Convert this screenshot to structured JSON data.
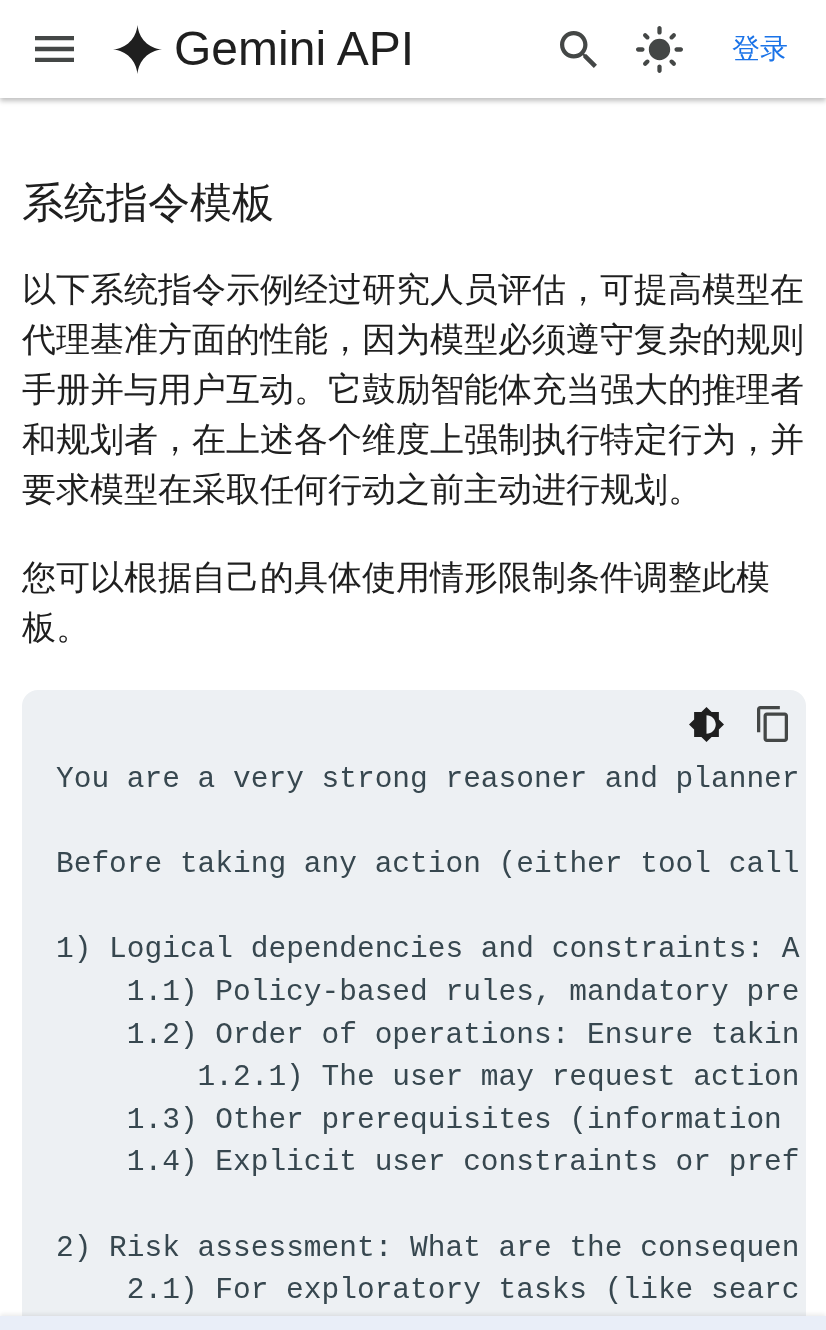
{
  "header": {
    "logo_text": "Gemini API",
    "sign_in": "登录"
  },
  "article": {
    "heading": "系统指令模板",
    "paragraphs": [
      "以下系统指令示例经过研究人员评估，可提高模型在代理基准方面的性能，因为模型必须遵守复杂的规则手册并与用户互动。它鼓励智能体充当强大的推理者和规划者，在上述各个维度上强制执行特定行为，并要求模型在采取任何行动之前主动进行规划。",
      "您可以根据自己的具体使用情形限制条件调整此模板。"
    ],
    "code_block": {
      "lines": [
        {
          "text": "You are a very strong reasoner and planner"
        },
        {
          "text": "Before taking any action (either tool call"
        },
        {
          "text": "1) Logical dependencies and constraints: A",
          "children": [
            {
              "text": "1.1) Policy-based rules, mandatory pre"
            },
            {
              "text": "1.2) Order of operations: Ensure takin",
              "children": [
                {
                  "text": "1.2.1) The user may request action"
                }
              ]
            },
            {
              "text": "1.3) Other prerequisites (information"
            },
            {
              "text": "1.4) Explicit user constraints or pref"
            }
          ]
        },
        {
          "text": "2) Risk assessment: What are the consequen",
          "children": [
            {
              "text": "2.1) For exploratory tasks (like searc"
            }
          ]
        }
      ]
    }
  }
}
